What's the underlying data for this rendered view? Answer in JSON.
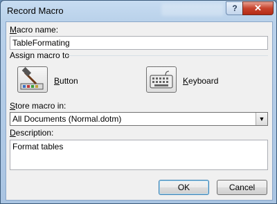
{
  "window": {
    "title": "Record Macro"
  },
  "fields": {
    "macro_name_label": "Macro name:",
    "macro_name_value": "TableFormating",
    "assign_label": "Assign macro to",
    "button_label": "Button",
    "keyboard_label": "Keyboard",
    "store_label": "Store macro in:",
    "store_value": "All Documents (Normal.dotm)",
    "description_label": "Description:",
    "description_value": "Format tables"
  },
  "buttons": {
    "ok": "OK",
    "cancel": "Cancel"
  },
  "icons": {
    "help": "help-icon",
    "close": "close-icon",
    "button": "hammer-toolbar-icon",
    "keyboard": "keyboard-icon",
    "dropdown": "chevron-down-icon"
  },
  "colors": {
    "close_button": "#c7432d",
    "frame": "#b9d1ea"
  }
}
